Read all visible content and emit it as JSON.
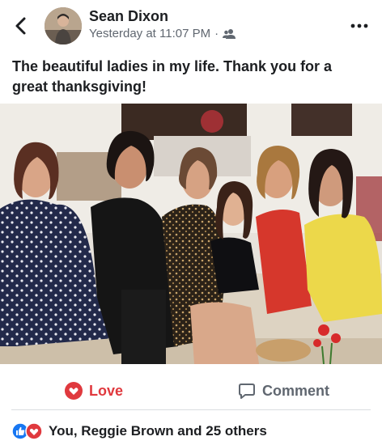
{
  "post": {
    "author": "Sean Dixon",
    "timestamp": "Yesterday at 11:07 PM",
    "separator": "·",
    "audience_icon": "friends-icon",
    "caption": "The beautiful ladies in my life. Thank you for a great thanksgiving!",
    "photo_alt": "group-photo"
  },
  "actions": {
    "love_label": "Love",
    "comment_label": "Comment"
  },
  "reactions": {
    "summary": "You, Reggie Brown and 25 others",
    "icons": [
      "like-icon",
      "love-icon"
    ]
  },
  "colors": {
    "love": "#e0393e",
    "like": "#1877f2",
    "secondary_text": "#606770"
  }
}
